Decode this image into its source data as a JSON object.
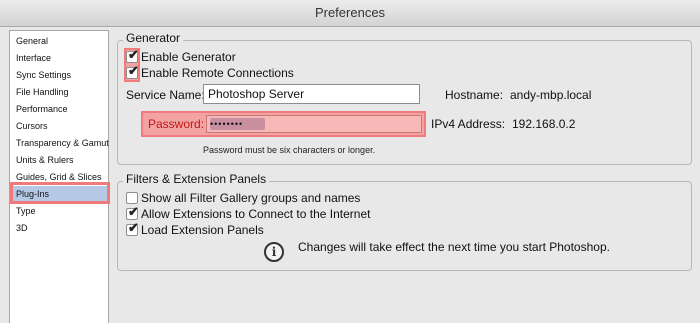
{
  "window": {
    "title": "Preferences"
  },
  "sidebar": {
    "items": [
      {
        "label": "General"
      },
      {
        "label": "Interface"
      },
      {
        "label": "Sync Settings"
      },
      {
        "label": "File Handling"
      },
      {
        "label": "Performance"
      },
      {
        "label": "Cursors"
      },
      {
        "label": "Transparency & Gamut"
      },
      {
        "label": "Units & Rulers"
      },
      {
        "label": "Guides, Grid & Slices"
      },
      {
        "label": "Plug-Ins",
        "selected": true
      },
      {
        "label": "Type"
      },
      {
        "label": "3D"
      }
    ]
  },
  "generator": {
    "legend": "Generator",
    "enable_generator": {
      "label": "Enable Generator",
      "checked": true
    },
    "enable_remote": {
      "label": "Enable Remote Connections",
      "checked": true
    },
    "service_name_label": "Service Name:",
    "service_name_value": "Photoshop Server",
    "hostname_label": "Hostname:",
    "hostname_value": "andy-mbp.local",
    "password_label": "Password:",
    "password_value": "••••••••",
    "ipv4_label": "IPv4 Address:",
    "ipv4_value": "192.168.0.2",
    "password_hint": "Password must be six characters or longer."
  },
  "filters": {
    "legend": "Filters & Extension Panels",
    "show_filter_gallery": {
      "label": "Show all Filter Gallery groups and names",
      "checked": false
    },
    "allow_extensions": {
      "label": "Allow Extensions to Connect to the Internet",
      "checked": true
    },
    "load_extension_panels": {
      "label": "Load Extension Panels",
      "checked": true
    },
    "notice": "Changes will take effect the next time you start Photoshop.",
    "notice_icon": "info-icon",
    "check_glyph": "✔",
    "info_glyph": "i"
  },
  "colors": {
    "highlight": "#f07a7a",
    "selection": "#b5c8e6"
  }
}
